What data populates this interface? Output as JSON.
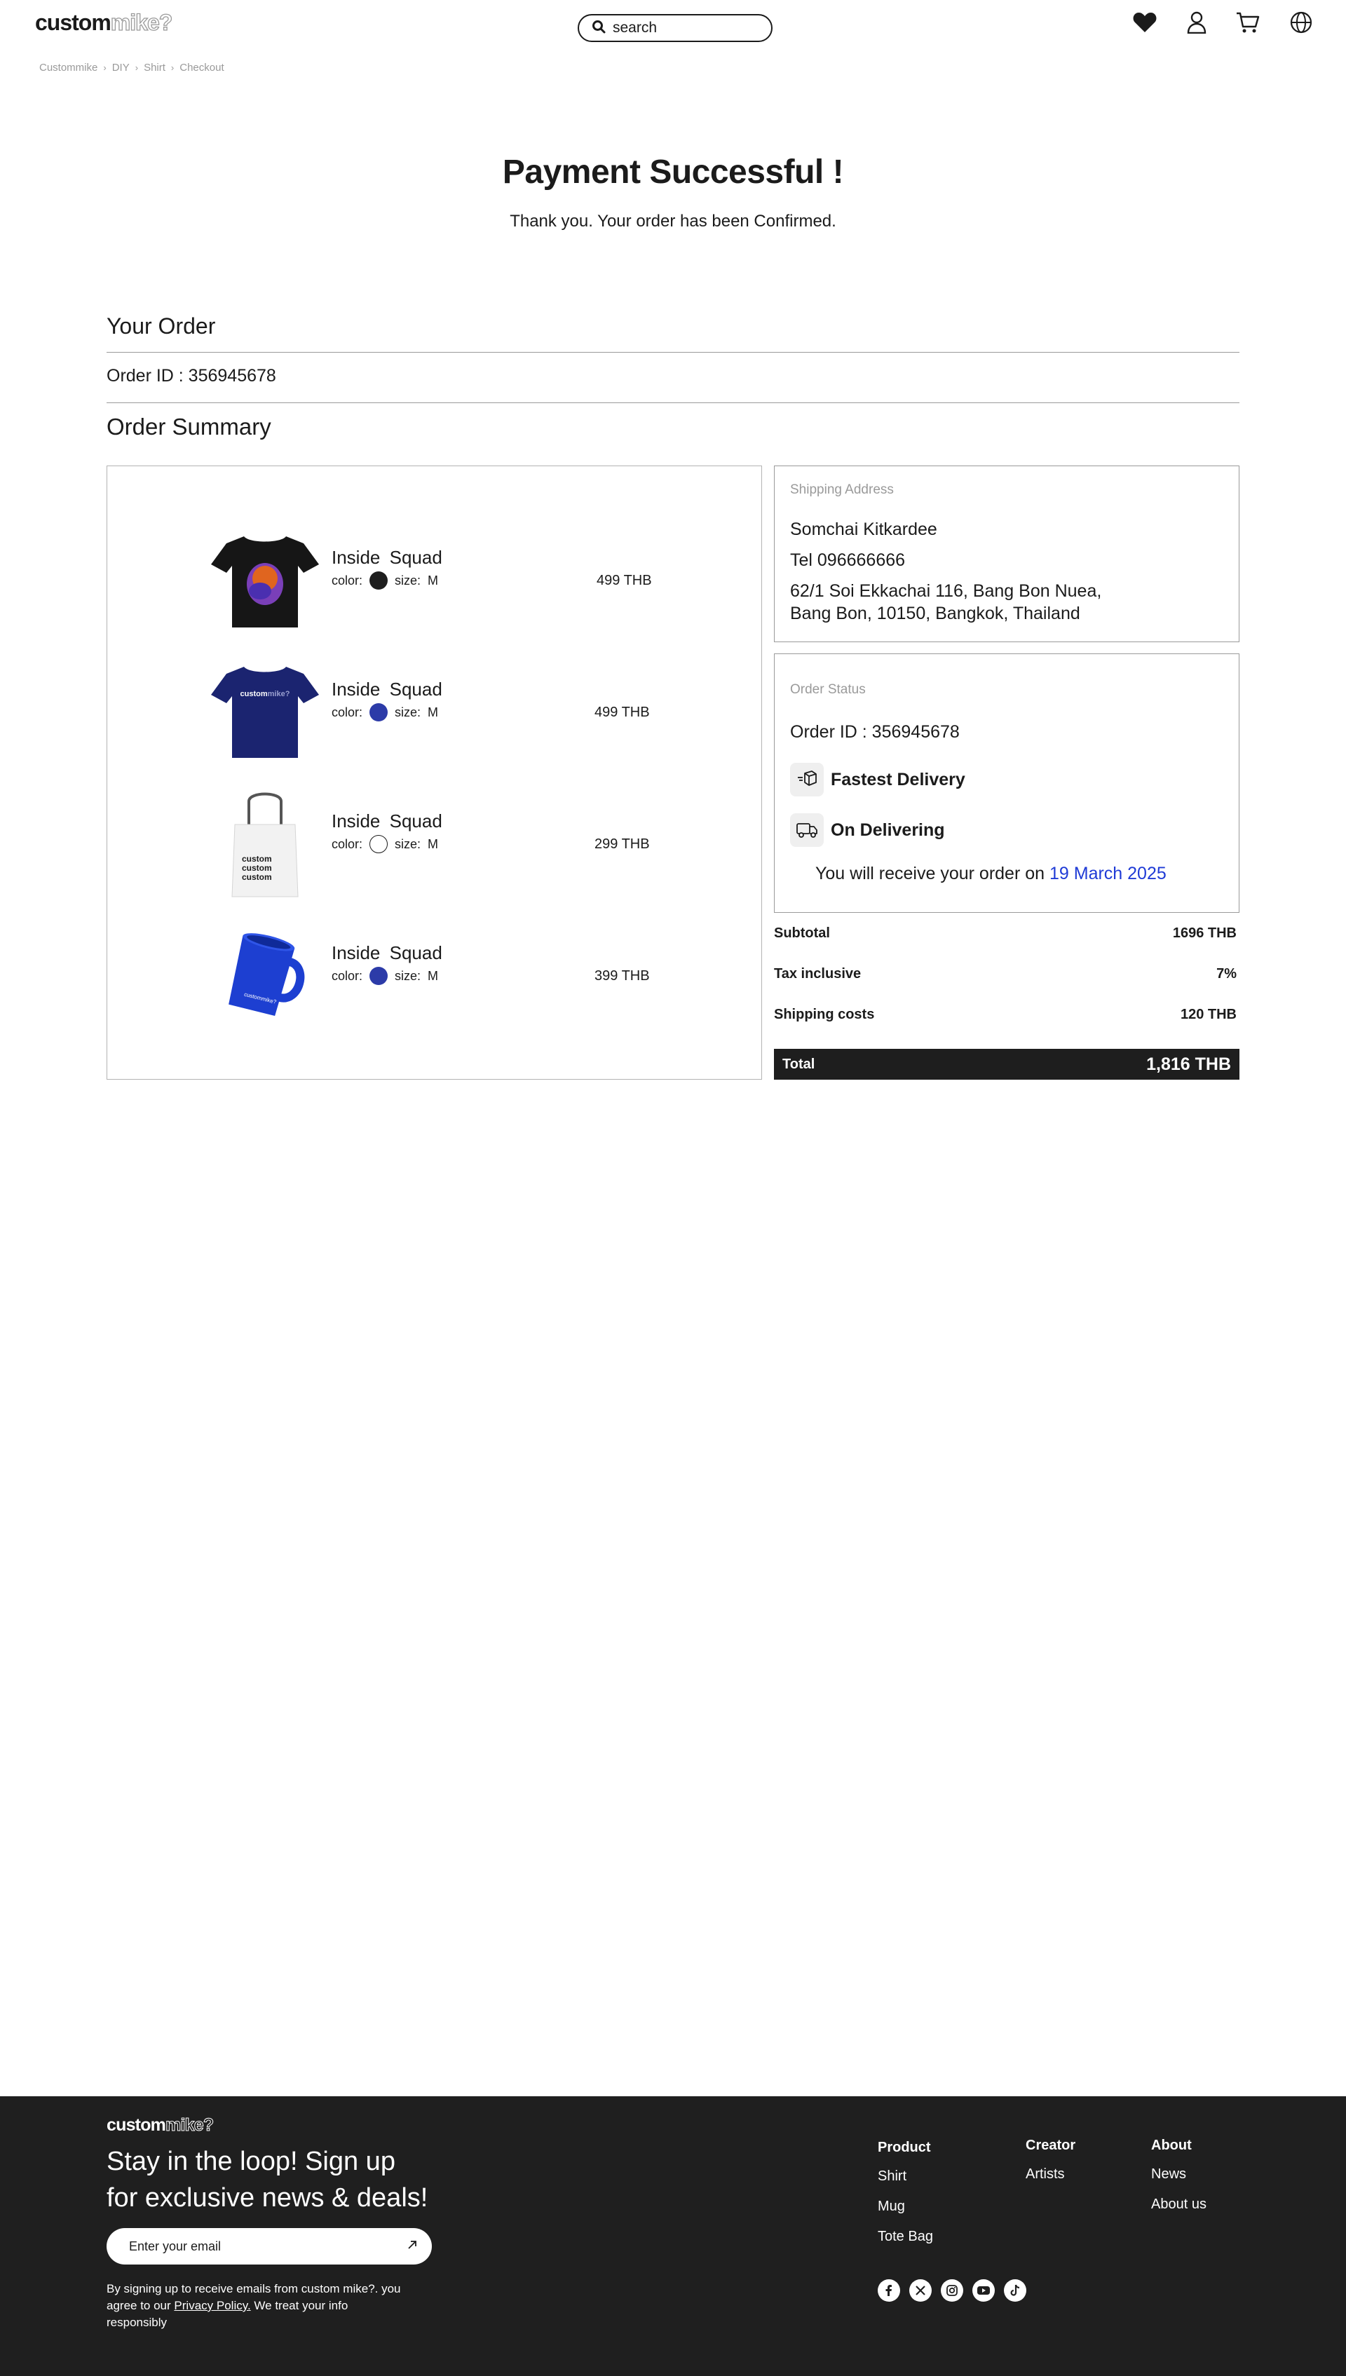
{
  "header": {
    "logo_bold": "custom",
    "logo_outline": "mike?",
    "search_placeholder": "search",
    "icons": [
      "heart-icon",
      "user-icon",
      "cart-icon",
      "globe-icon"
    ]
  },
  "breadcrumb": [
    "Custommike",
    "DIY",
    "Shirt",
    "Checkout"
  ],
  "hero": {
    "title": "Payment Successful !",
    "subtitle": "Thank you. Your order has been Confirmed."
  },
  "your_order": {
    "title": "Your Order",
    "order_id": "Order ID : 356945678"
  },
  "order_summary": {
    "title": "Order Summary",
    "color_label": "color:",
    "size_label": "size:",
    "items": [
      {
        "name": "Inside Squad",
        "color": "#1e1e1e",
        "size": "M",
        "price": "499 THB",
        "image": "black-tshirt"
      },
      {
        "name": "Inside Squad",
        "color": "#2c3ba8",
        "size": "M",
        "price": "499 THB",
        "image": "navy-tshirt"
      },
      {
        "name": "Inside Squad",
        "color": "#ffffff",
        "size": "M",
        "price": "299 THB",
        "image": "white-tote-bag"
      },
      {
        "name": "Inside Squad",
        "color": "#2c3ba8",
        "size": "M",
        "price": "399 THB",
        "image": "blue-mug"
      }
    ]
  },
  "shipping": {
    "label": "Shipping Address",
    "name": "Somchai Kitkardee",
    "tel": "Tel 096666666",
    "address_line1": "62/1 Soi Ekkachai 116, Bang Bon Nuea,",
    "address_line2": "Bang Bon, 10150, Bangkok, Thailand"
  },
  "order_status": {
    "label": "Order Status",
    "order_id": "Order ID : 356945678",
    "delivery_type": "Fastest Delivery",
    "status": "On Delivering",
    "receive_text": "You will receive your order on",
    "receive_date": "19 March 2025"
  },
  "totals": {
    "subtotal_label": "Subtotal",
    "subtotal_value": "1696 THB",
    "tax_label": "Tax inclusive",
    "tax_value": "7%",
    "shipping_label": "Shipping costs",
    "shipping_value": "120 THB",
    "total_label": "Total",
    "total_value": "1,816 THB"
  },
  "footer": {
    "logo_bold": "custom",
    "logo_outline": "mike?",
    "headline_line1": "Stay in the loop! Sign up",
    "headline_line2": "for exclusive news & deals!",
    "email_placeholder": "Enter your email",
    "note_before": "By signing up to receive emails from custom mike?. you agree to our",
    "privacy_link": "Privacy Policy.",
    "note_after": "We treat your info responsibly",
    "columns": {
      "product": {
        "title": "Product",
        "links": [
          "Shirt",
          "Mug",
          "Tote Bag"
        ]
      },
      "creator": {
        "title": "Creator",
        "links": [
          "Artists"
        ]
      },
      "about": {
        "title": "About",
        "links": [
          "News",
          "About us"
        ]
      }
    },
    "social_icons": [
      "facebook-icon",
      "x-icon",
      "instagram-icon",
      "youtube-icon",
      "tiktok-icon"
    ]
  },
  "colors": {
    "accent_date": "#1f3bd6",
    "footer_bg": "#1f1f1f",
    "total_bg": "#1e1e1e",
    "muted_text": "#9a9a9a"
  }
}
